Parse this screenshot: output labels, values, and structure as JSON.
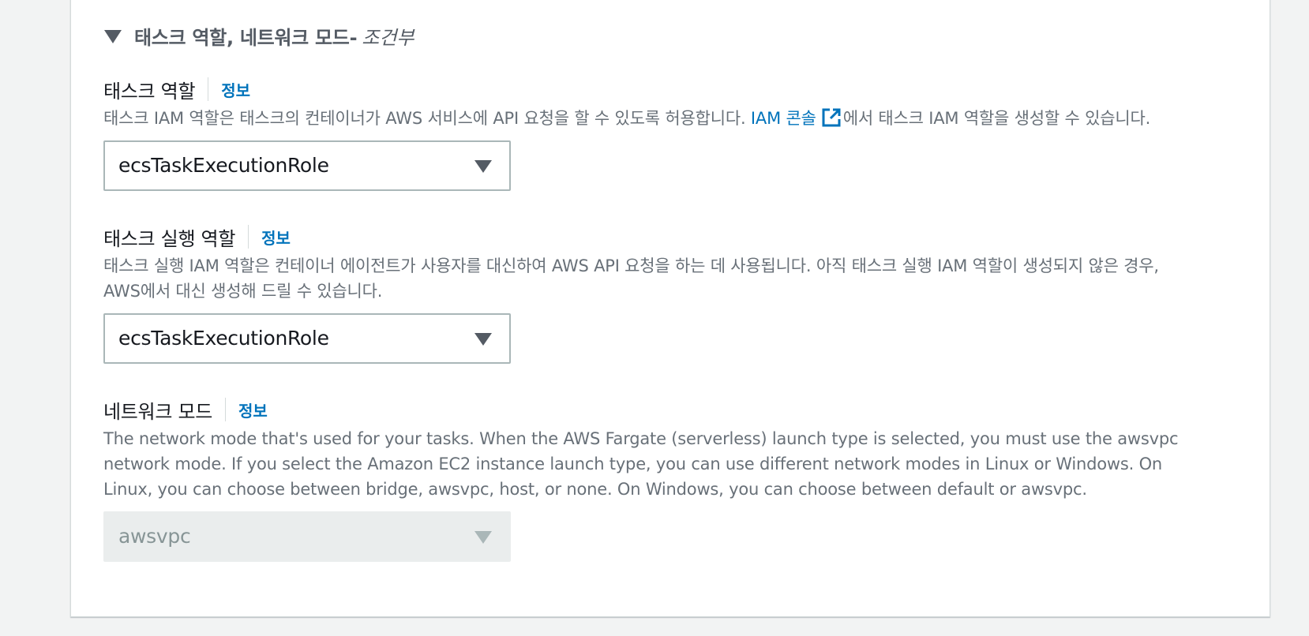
{
  "section": {
    "title": "태스크 역할, 네트워크 모드-",
    "title_suffix": "조건부"
  },
  "task_role": {
    "label": "태스크 역할",
    "info": "정보",
    "desc_before": "태스크 IAM 역할은 태스크의 컨테이너가 AWS 서비스에 API 요청을 할 수 있도록 허용합니다.",
    "desc_link": "IAM 콘솔",
    "desc_after": "에서 태스크 IAM 역할을 생성할 수 있습니다.",
    "value": "ecsTaskExecutionRole"
  },
  "execution_role": {
    "label": "태스크 실행 역할",
    "info": "정보",
    "desc_line1": "태스크 실행 IAM 역할은 컨테이너 에이전트가 사용자를 대신하여 AWS API 요청을 하는 데 사용됩니다. 아직 태스크 실행 IAM 역할이 생성되지 않은 경우,",
    "desc_line2": "AWS에서 대신 생성해 드릴 수 있습니다.",
    "value": "ecsTaskExecutionRole"
  },
  "network_mode": {
    "label": "네트워크 모드",
    "info": "정보",
    "desc_line1": "The network mode that's used for your tasks. When the AWS Fargate (serverless) launch type is selected, you must use the awsvpc",
    "desc_line2": "network mode. If you select the Amazon EC2 instance launch type, you can use different network modes in Linux or Windows. On",
    "desc_line3": "Linux, you can choose between bridge, awsvpc, host, or none. On Windows, you can choose between default or awsvpc.",
    "value": "awsvpc"
  },
  "colors": {
    "link": "#0073bb",
    "text": "#16191f",
    "muted": "#687078",
    "disabled_bg": "#eaeded"
  }
}
